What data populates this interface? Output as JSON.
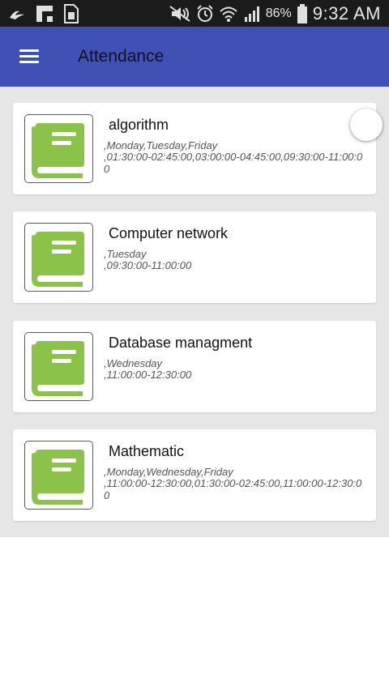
{
  "status_bar": {
    "battery": "86%",
    "time": "9:32 AM",
    "left_icons": [
      "tips-icon",
      "flipboard-icon",
      "sim-icon"
    ],
    "right_icons": [
      "mute-icon",
      "alarm-icon",
      "wifi-icon",
      "signal-icon",
      "battery-icon"
    ]
  },
  "app_bar": {
    "title": "Attendance",
    "color": "#3f51b5"
  },
  "courses": [
    {
      "name": "algorithm",
      "days": ",Monday,Tuesday,Friday",
      "times": ",01:30:00-02:45:00,03:00:00-04:45:00,09:30:00-11:00:00"
    },
    {
      "name": "Computer network",
      "days": ",Tuesday",
      "times": ",09:30:00-11:00:00"
    },
    {
      "name": "Database managment",
      "days": ",Wednesday",
      "times": ",11:00:00-12:30:00"
    },
    {
      "name": "Mathematic",
      "days": ",Monday,Wednesday,Friday",
      "times": ",11:00:00-12:30:00,01:30:00-02:45:00,11:00:00-12:30:00"
    }
  ],
  "colors": {
    "book_green": "#8bc34a",
    "list_background": "#e6e6e6"
  }
}
